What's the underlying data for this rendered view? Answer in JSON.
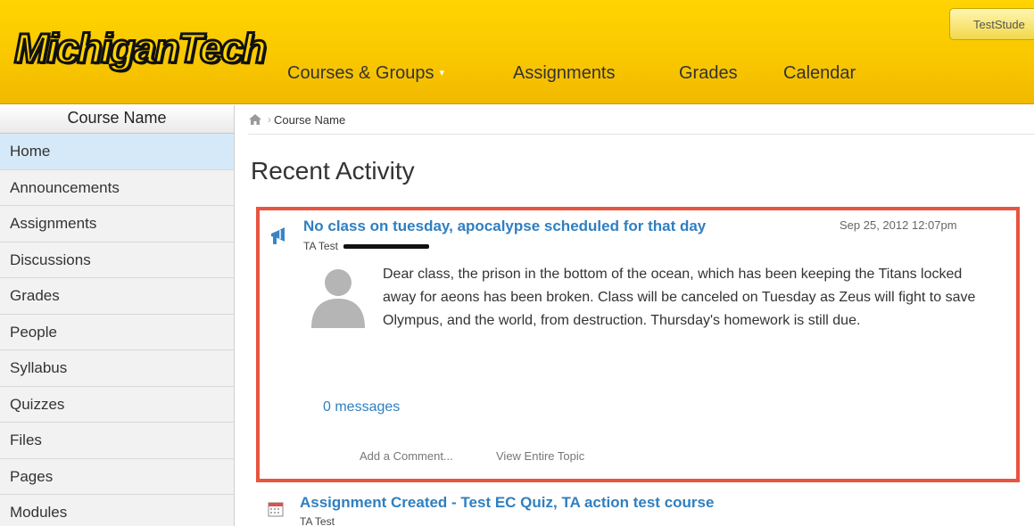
{
  "header": {
    "logo_text": "MichiganTech",
    "user_label": "TestStude",
    "nav": [
      {
        "label": "Courses & Groups",
        "caret": "▾"
      },
      {
        "label": "Assignments"
      },
      {
        "label": "Grades"
      },
      {
        "label": "Calendar"
      }
    ]
  },
  "sidebar": {
    "title": "Course Name",
    "items": [
      {
        "label": "Home",
        "active": true
      },
      {
        "label": "Announcements"
      },
      {
        "label": "Assignments"
      },
      {
        "label": "Discussions"
      },
      {
        "label": "Grades"
      },
      {
        "label": "People"
      },
      {
        "label": "Syllabus"
      },
      {
        "label": "Quizzes"
      },
      {
        "label": "Files"
      },
      {
        "label": "Pages"
      },
      {
        "label": "Modules"
      }
    ]
  },
  "breadcrumb": {
    "separator": "›",
    "items": [
      "Course Name"
    ]
  },
  "main": {
    "title": "Recent Activity",
    "activities": [
      {
        "icon": "megaphone-icon",
        "title": "No class on tuesday, apocalypse scheduled for that day",
        "date": "Sep 25, 2012 12:07pm",
        "author": "TA Test",
        "body": "Dear class, the prison in the bottom of the ocean, which has been keeping the Titans locked away for aeons has been broken. Class will be canceled on Tuesday as Zeus will fight to save Olympus, and the world, from destruction. Thursday's homework is still due.",
        "messages_link": "0 messages",
        "actions": [
          "Add a Comment...",
          "View Entire Topic"
        ]
      },
      {
        "icon": "calendar-icon",
        "title": "Assignment Created - Test EC Quiz, TA action test course",
        "author": "TA Test"
      }
    ]
  },
  "colors": {
    "header_yellow": "#ffd400",
    "highlight_border": "#e8543f",
    "link_blue": "#2f7fc1",
    "active_nav": "#d6e9f8"
  }
}
